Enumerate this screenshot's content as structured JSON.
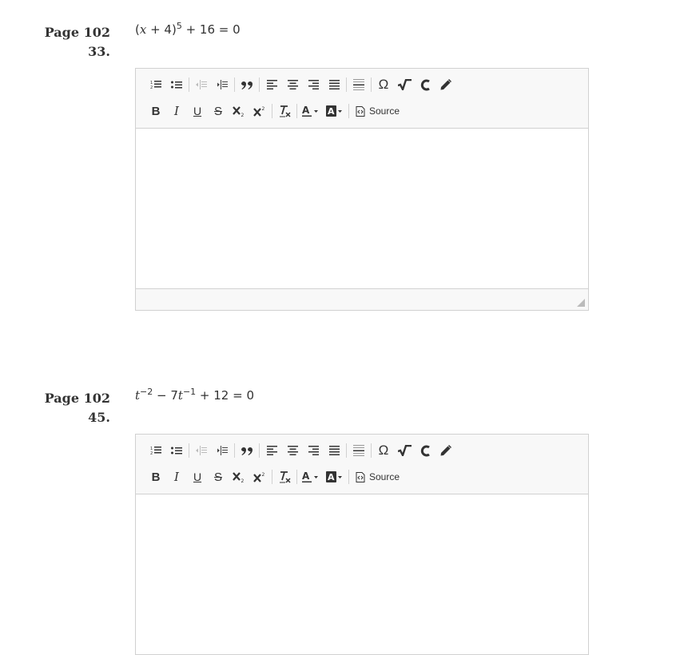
{
  "questions": [
    {
      "page_label": "Page 102",
      "number": "33.",
      "equation": {
        "p1": "(",
        "v1": "x",
        "p2": " + 4)",
        "s1": "5",
        "p3": " + 16 = 0"
      }
    },
    {
      "page_label": "Page 102",
      "number": "45.",
      "equation": {
        "v1": "t",
        "s1": "−2",
        "p1": " − 7",
        "v2": "t",
        "s2": "−1",
        "p2": " + 12 = 0"
      }
    }
  ],
  "toolbar": {
    "source_label": "Source",
    "omega_symbol": "Ω",
    "icons": [
      "numbered-list-icon",
      "bulleted-list-icon",
      "outdent-icon",
      "indent-icon",
      "blockquote-icon",
      "align-left-icon",
      "align-center-icon",
      "align-right-icon",
      "justify-icon",
      "horizontal-rule-icon",
      "omega-icon",
      "sqrt-icon",
      "c-icon",
      "pencil-icon",
      "bold-icon",
      "italic-icon",
      "underline-icon",
      "strikethrough-icon",
      "subscript-icon",
      "superscript-icon",
      "remove-format-icon",
      "text-color-icon",
      "background-color-icon",
      "source-icon"
    ]
  }
}
